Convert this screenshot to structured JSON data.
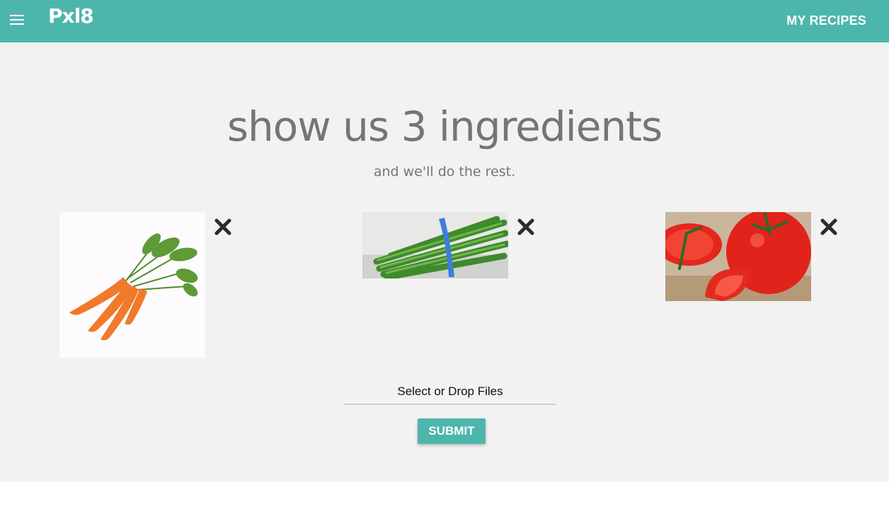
{
  "header": {
    "brand": "Pxl8",
    "menu_icon": "hamburger-menu-icon",
    "nav_link": "MY RECIPES"
  },
  "hero": {
    "title": "show us 3 ingredients",
    "subtitle": "and we'll do the rest."
  },
  "ingredients": [
    {
      "name": "carrots",
      "remove_icon": "close-icon"
    },
    {
      "name": "asparagus",
      "remove_icon": "close-icon"
    },
    {
      "name": "tomatoes",
      "remove_icon": "close-icon"
    }
  ],
  "upload": {
    "label": "Select or Drop Files"
  },
  "submit": {
    "label": "SUBMIT"
  },
  "colors": {
    "primary": "#4db6ac",
    "background": "#f2f2f2",
    "text_muted": "#757575"
  }
}
